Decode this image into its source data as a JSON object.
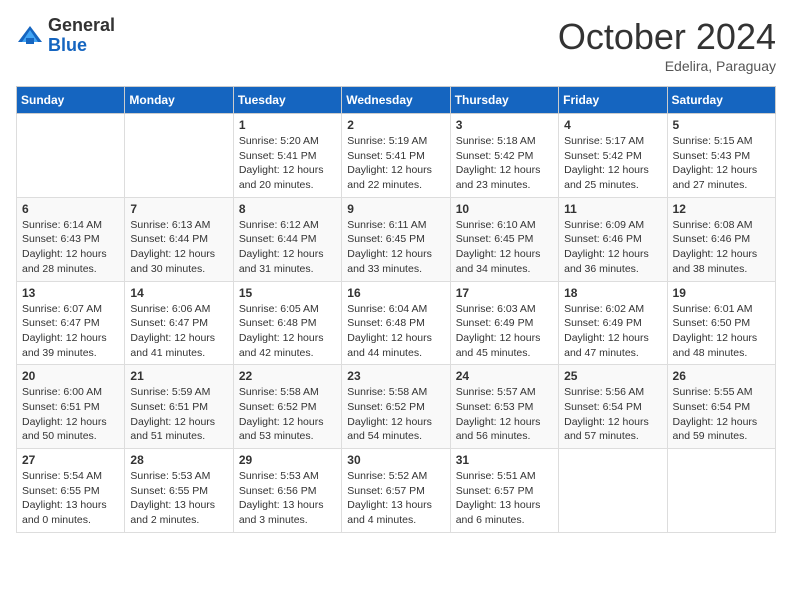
{
  "header": {
    "logo_general": "General",
    "logo_blue": "Blue",
    "month_title": "October 2024",
    "subtitle": "Edelira, Paraguay"
  },
  "weekdays": [
    "Sunday",
    "Monday",
    "Tuesday",
    "Wednesday",
    "Thursday",
    "Friday",
    "Saturday"
  ],
  "weeks": [
    [
      {
        "day": "",
        "info": ""
      },
      {
        "day": "",
        "info": ""
      },
      {
        "day": "1",
        "info": "Sunrise: 5:20 AM\nSunset: 5:41 PM\nDaylight: 12 hours and 20 minutes."
      },
      {
        "day": "2",
        "info": "Sunrise: 5:19 AM\nSunset: 5:41 PM\nDaylight: 12 hours and 22 minutes."
      },
      {
        "day": "3",
        "info": "Sunrise: 5:18 AM\nSunset: 5:42 PM\nDaylight: 12 hours and 23 minutes."
      },
      {
        "day": "4",
        "info": "Sunrise: 5:17 AM\nSunset: 5:42 PM\nDaylight: 12 hours and 25 minutes."
      },
      {
        "day": "5",
        "info": "Sunrise: 5:15 AM\nSunset: 5:43 PM\nDaylight: 12 hours and 27 minutes."
      }
    ],
    [
      {
        "day": "6",
        "info": "Sunrise: 6:14 AM\nSunset: 6:43 PM\nDaylight: 12 hours and 28 minutes."
      },
      {
        "day": "7",
        "info": "Sunrise: 6:13 AM\nSunset: 6:44 PM\nDaylight: 12 hours and 30 minutes."
      },
      {
        "day": "8",
        "info": "Sunrise: 6:12 AM\nSunset: 6:44 PM\nDaylight: 12 hours and 31 minutes."
      },
      {
        "day": "9",
        "info": "Sunrise: 6:11 AM\nSunset: 6:45 PM\nDaylight: 12 hours and 33 minutes."
      },
      {
        "day": "10",
        "info": "Sunrise: 6:10 AM\nSunset: 6:45 PM\nDaylight: 12 hours and 34 minutes."
      },
      {
        "day": "11",
        "info": "Sunrise: 6:09 AM\nSunset: 6:46 PM\nDaylight: 12 hours and 36 minutes."
      },
      {
        "day": "12",
        "info": "Sunrise: 6:08 AM\nSunset: 6:46 PM\nDaylight: 12 hours and 38 minutes."
      }
    ],
    [
      {
        "day": "13",
        "info": "Sunrise: 6:07 AM\nSunset: 6:47 PM\nDaylight: 12 hours and 39 minutes."
      },
      {
        "day": "14",
        "info": "Sunrise: 6:06 AM\nSunset: 6:47 PM\nDaylight: 12 hours and 41 minutes."
      },
      {
        "day": "15",
        "info": "Sunrise: 6:05 AM\nSunset: 6:48 PM\nDaylight: 12 hours and 42 minutes."
      },
      {
        "day": "16",
        "info": "Sunrise: 6:04 AM\nSunset: 6:48 PM\nDaylight: 12 hours and 44 minutes."
      },
      {
        "day": "17",
        "info": "Sunrise: 6:03 AM\nSunset: 6:49 PM\nDaylight: 12 hours and 45 minutes."
      },
      {
        "day": "18",
        "info": "Sunrise: 6:02 AM\nSunset: 6:49 PM\nDaylight: 12 hours and 47 minutes."
      },
      {
        "day": "19",
        "info": "Sunrise: 6:01 AM\nSunset: 6:50 PM\nDaylight: 12 hours and 48 minutes."
      }
    ],
    [
      {
        "day": "20",
        "info": "Sunrise: 6:00 AM\nSunset: 6:51 PM\nDaylight: 12 hours and 50 minutes."
      },
      {
        "day": "21",
        "info": "Sunrise: 5:59 AM\nSunset: 6:51 PM\nDaylight: 12 hours and 51 minutes."
      },
      {
        "day": "22",
        "info": "Sunrise: 5:58 AM\nSunset: 6:52 PM\nDaylight: 12 hours and 53 minutes."
      },
      {
        "day": "23",
        "info": "Sunrise: 5:58 AM\nSunset: 6:52 PM\nDaylight: 12 hours and 54 minutes."
      },
      {
        "day": "24",
        "info": "Sunrise: 5:57 AM\nSunset: 6:53 PM\nDaylight: 12 hours and 56 minutes."
      },
      {
        "day": "25",
        "info": "Sunrise: 5:56 AM\nSunset: 6:54 PM\nDaylight: 12 hours and 57 minutes."
      },
      {
        "day": "26",
        "info": "Sunrise: 5:55 AM\nSunset: 6:54 PM\nDaylight: 12 hours and 59 minutes."
      }
    ],
    [
      {
        "day": "27",
        "info": "Sunrise: 5:54 AM\nSunset: 6:55 PM\nDaylight: 13 hours and 0 minutes."
      },
      {
        "day": "28",
        "info": "Sunrise: 5:53 AM\nSunset: 6:55 PM\nDaylight: 13 hours and 2 minutes."
      },
      {
        "day": "29",
        "info": "Sunrise: 5:53 AM\nSunset: 6:56 PM\nDaylight: 13 hours and 3 minutes."
      },
      {
        "day": "30",
        "info": "Sunrise: 5:52 AM\nSunset: 6:57 PM\nDaylight: 13 hours and 4 minutes."
      },
      {
        "day": "31",
        "info": "Sunrise: 5:51 AM\nSunset: 6:57 PM\nDaylight: 13 hours and 6 minutes."
      },
      {
        "day": "",
        "info": ""
      },
      {
        "day": "",
        "info": ""
      }
    ]
  ]
}
